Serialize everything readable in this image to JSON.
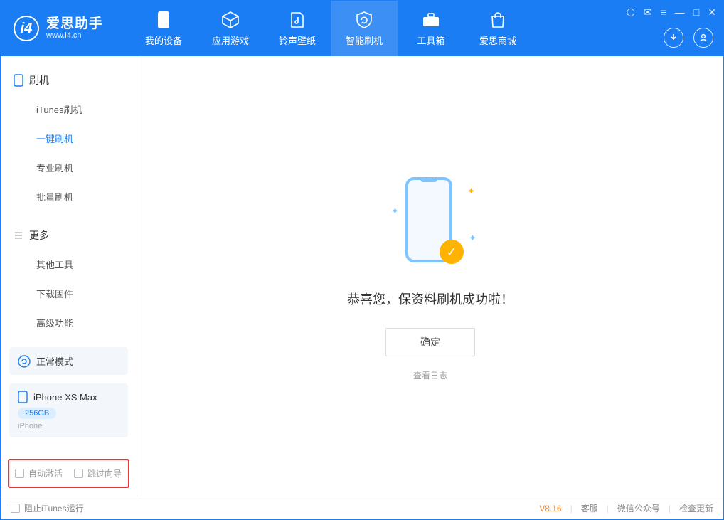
{
  "app": {
    "name_cn": "爱思助手",
    "url": "www.i4.cn"
  },
  "nav": {
    "my_device": "我的设备",
    "apps_games": "应用游戏",
    "ring_wall": "铃声壁纸",
    "smart_flash": "智能刷机",
    "toolbox": "工具箱",
    "store": "爱思商城"
  },
  "sidebar": {
    "flash_header": "刷机",
    "itunes_flash": "iTunes刷机",
    "one_click_flash": "一键刷机",
    "pro_flash": "专业刷机",
    "batch_flash": "批量刷机",
    "more_header": "更多",
    "other_tools": "其他工具",
    "download_fw": "下载固件",
    "advanced": "高级功能"
  },
  "status": {
    "mode": "正常模式"
  },
  "device": {
    "name": "iPhone XS Max",
    "storage": "256GB",
    "type": "iPhone"
  },
  "options": {
    "auto_activate": "自动激活",
    "skip_guide": "跳过向导"
  },
  "main": {
    "success_msg": "恭喜您，保资料刷机成功啦！",
    "ok": "确定",
    "view_log": "查看日志"
  },
  "footer": {
    "block_itunes": "阻止iTunes运行",
    "version": "V8.16",
    "support": "客服",
    "wechat": "微信公众号",
    "check_update": "检查更新"
  }
}
